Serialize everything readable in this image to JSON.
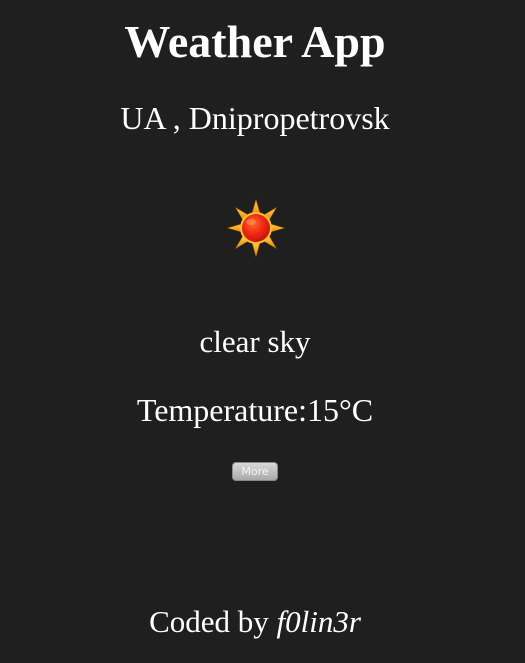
{
  "app": {
    "title": "Weather App"
  },
  "weather": {
    "location": "UA , Dnipropetrovsk",
    "icon": "sun-icon",
    "description": "clear sky",
    "temperature": "Temperature:15°C"
  },
  "actions": {
    "more_label": "More"
  },
  "footer": {
    "prefix": "Coded by ",
    "author": "f0lin3r"
  }
}
